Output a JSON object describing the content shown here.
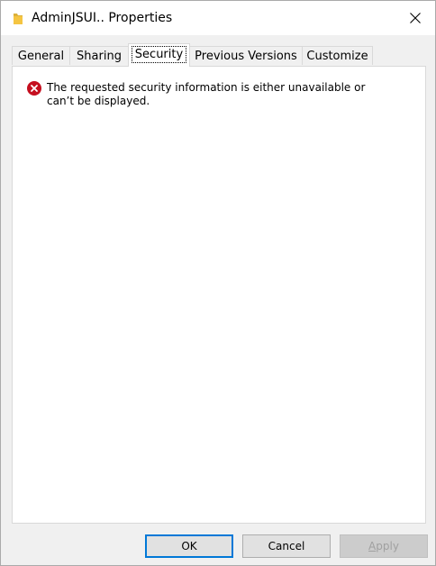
{
  "window": {
    "title": "AdminJSUI.. Properties",
    "icon": "folder-icon",
    "close_icon": "close-icon"
  },
  "tabs": [
    {
      "label": "General",
      "active": false
    },
    {
      "label": "Sharing",
      "active": false
    },
    {
      "label": "Security",
      "active": true
    },
    {
      "label": "Previous Versions",
      "active": false
    },
    {
      "label": "Customize",
      "active": false
    }
  ],
  "security": {
    "error_icon": "error-icon",
    "message": "The requested security information is either unavailable or can’t be displayed."
  },
  "buttons": {
    "ok": "OK",
    "cancel": "Cancel",
    "apply": "Apply",
    "apply_mnemonic": "A",
    "apply_rest": "pply",
    "apply_enabled": false
  },
  "colors": {
    "accent": "#0078d7",
    "error": "#c50f1f",
    "folder": "#f5c542"
  }
}
